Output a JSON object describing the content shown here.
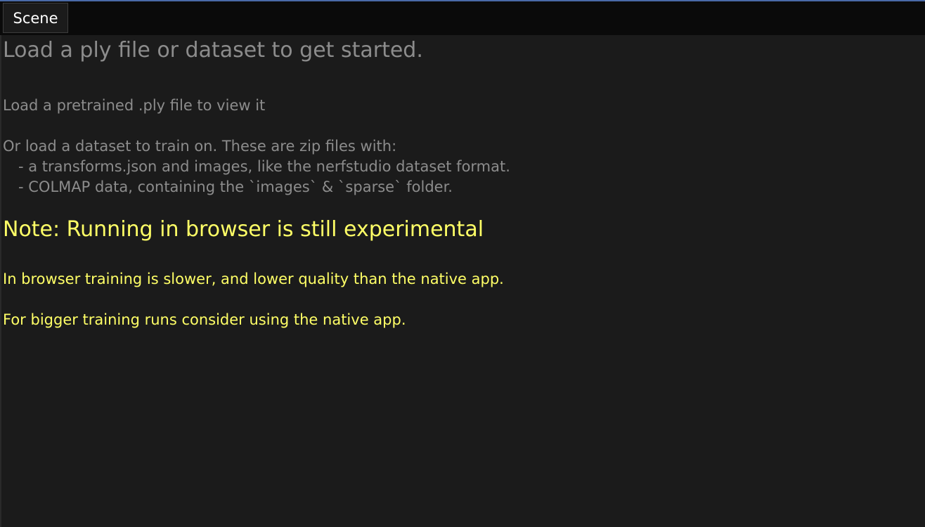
{
  "tabs": {
    "scene_label": "Scene"
  },
  "intro": {
    "heading": "Load a ply file or dataset to get started.",
    "ply_line": "Load a pretrained .ply file to view it",
    "dataset_line": "Or load a dataset to train on. These are zip files with:",
    "bullets": [
      "- a transforms.json and images, like the nerfstudio dataset format.",
      "- COLMAP data, containing the `images` & `sparse` folder."
    ]
  },
  "note": {
    "heading": "Note: Running in browser is still experimental",
    "line1": "In browser training is slower, and lower quality than the native app.",
    "line2": "For bigger training runs consider using the native app."
  },
  "colors": {
    "background": "#1b1b1b",
    "text_gray": "#8c8c8c",
    "warning_yellow": "#ffff66",
    "accent": "#4a6aa8"
  }
}
